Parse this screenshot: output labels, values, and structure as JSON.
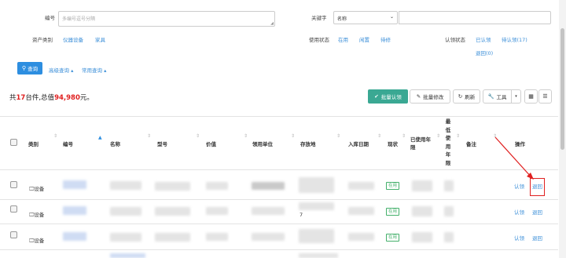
{
  "filters": {
    "code_label": "编号",
    "code_placeholder": "多编号逗号分隔",
    "keyword_label": "关键字",
    "keyword_select": "名称",
    "category_label": "资产类别",
    "category_options": [
      "仪器设备",
      "家具"
    ],
    "use_status_label": "使用状态",
    "use_status_options": [
      "在用",
      "闲置",
      "待修"
    ],
    "claim_status_label": "认领状态",
    "claim_status_options": [
      "已认领",
      "待认领(17)",
      "退回(0)"
    ],
    "search_button": "查询",
    "advanced_search": "高级查询",
    "common_search": "常用查询"
  },
  "summary": {
    "prefix": "共",
    "count": "17",
    "middle": "台件,总值",
    "total": "94,980",
    "suffix": "元。"
  },
  "toolbar": {
    "batch_claim": "批量认领",
    "batch_edit": "批量修改",
    "refresh": "刷新",
    "tools": "工具"
  },
  "table": {
    "columns": [
      "类别",
      "编号",
      "名称",
      "型号",
      "价值",
      "领用单位",
      "存放地",
      "入库日期",
      "现状",
      "已使用年限",
      "最低使用年限",
      "备注",
      "操作"
    ],
    "min_years_lines": [
      "最",
      "低",
      "使",
      "用",
      "年",
      "限"
    ],
    "rows": [
      {
        "category": "设备",
        "status": "在用",
        "claim": "认领",
        "return": "退回",
        "storage_extra": ""
      },
      {
        "category": "设备",
        "status": "在用",
        "claim": "认领",
        "return": "退回",
        "storage_extra": "7"
      },
      {
        "category": "设备",
        "status": "在用",
        "claim": "认领",
        "return": "退回",
        "storage_extra": ""
      }
    ]
  },
  "colors": {
    "accent": "#3a8ed8",
    "search_btn": "#2d8ee0",
    "claim_btn": "#3aa893",
    "highlight": "#e02020",
    "status_green": "#44b06b"
  }
}
